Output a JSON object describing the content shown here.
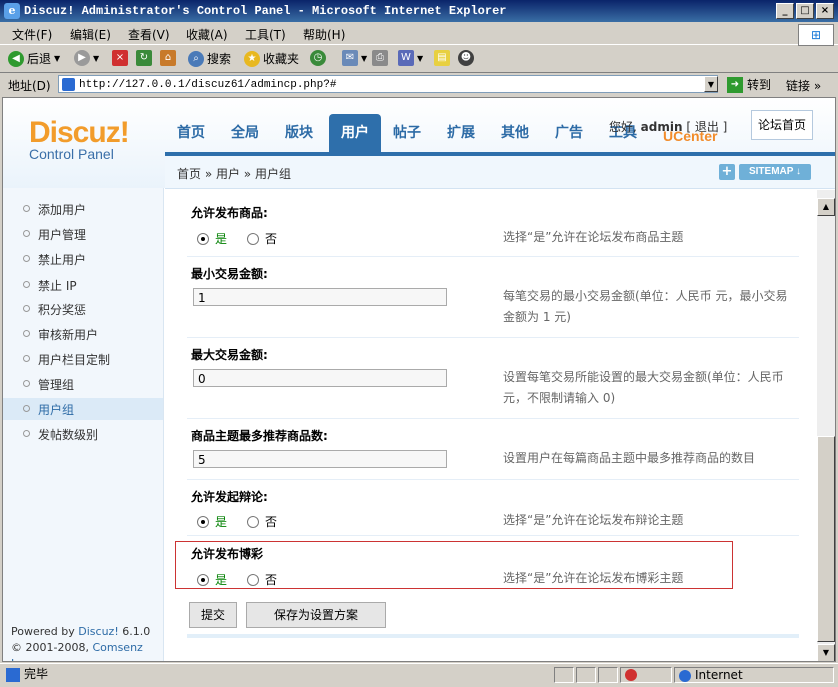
{
  "window": {
    "title": "Discuz! Administrator's Control Panel - Microsoft Internet Explorer",
    "controls": [
      "_",
      "□",
      "×"
    ]
  },
  "menubar": [
    "文件(F)",
    "编辑(E)",
    "查看(V)",
    "收藏(A)",
    "工具(T)",
    "帮助(H)"
  ],
  "toolbar": {
    "back": "后退",
    "search": "搜索",
    "favorites": "收藏夹"
  },
  "addressbar": {
    "label": "地址(D)",
    "url": "http://127.0.0.1/discuz61/admincp.php?#",
    "go": "转到",
    "links": "链接"
  },
  "logo": {
    "brand": "Discuz!",
    "sub": "Control Panel"
  },
  "nav": {
    "items": [
      "首页",
      "全局",
      "版块",
      "用户",
      "帖子",
      "扩展",
      "其他",
      "广告",
      "工具"
    ],
    "active": "用户"
  },
  "userinfo": {
    "greeting": "您好,",
    "username": "admin",
    "logout": "[ 退出 ]",
    "ucenter": "UCenter",
    "forum_home": "论坛首页"
  },
  "breadcrumb": "首页 » 用户 » 用户组",
  "sitemap": "SITEMAP",
  "sidebar": {
    "items": [
      "添加用户",
      "用户管理",
      "禁止用户",
      "禁止 IP",
      "积分奖惩",
      "审核新用户",
      "用户栏目定制",
      "管理组",
      "用户组",
      "发帖数级别"
    ],
    "active": "用户组",
    "footer_line1_prefix": "Powered by ",
    "footer_line1_link": "Discuz!",
    "footer_line1_suffix": " 6.1.0",
    "footer_line2_prefix": "© 2001-2008, ",
    "footer_line2_link": "Comsenz Inc."
  },
  "settings": [
    {
      "label": "允许发布商品:",
      "type": "radio",
      "yes": "是",
      "no": "否",
      "value": "是",
      "desc": "选择“是”允许在论坛发布商品主题"
    },
    {
      "label": "最小交易金额:",
      "type": "text",
      "value": "1",
      "desc": "每笔交易的最小交易金额(单位：人民币 元，最小交易金额为 1 元)"
    },
    {
      "label": "最大交易金额:",
      "type": "text",
      "value": "0",
      "desc": "设置每笔交易所能设置的最大交易金额(单位：人民币元，不限制请输入 0)"
    },
    {
      "label": "商品主题最多推荐商品数:",
      "type": "text",
      "value": "5",
      "desc": "设置用户在每篇商品主题中最多推荐商品的数目"
    },
    {
      "label": "允许发起辩论:",
      "type": "radio",
      "yes": "是",
      "no": "否",
      "value": "是",
      "desc": "选择“是”允许在论坛发布辩论主题"
    },
    {
      "label": "允许发布博彩",
      "type": "radio",
      "yes": "是",
      "no": "否",
      "value": "是",
      "desc": "选择“是”允许在论坛发布博彩主题"
    }
  ],
  "buttons": {
    "submit": "提交",
    "save_scheme": "保存为设置方案"
  },
  "statusbar": {
    "status": "完毕",
    "zone": "Internet"
  },
  "colors": {
    "accent": "#2e6fab",
    "logo": "#f29c2b",
    "highlight_border": "#cc3333"
  }
}
